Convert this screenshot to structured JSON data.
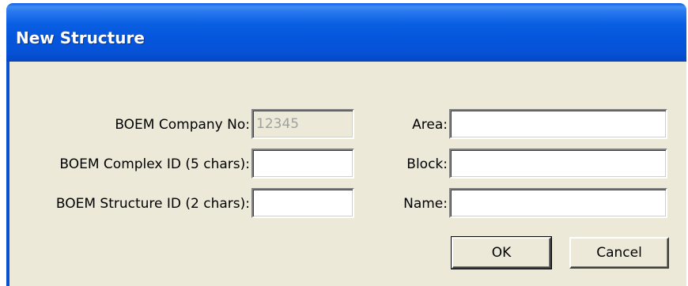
{
  "window": {
    "title": "New Structure"
  },
  "form": {
    "company_no": {
      "label": "BOEM Company No:",
      "value": "12345",
      "disabled": true
    },
    "complex_id": {
      "label": "BOEM Complex ID (5 chars):",
      "value": ""
    },
    "structure_id": {
      "label": "BOEM Structure ID (2 chars):",
      "value": ""
    },
    "area": {
      "label": "Area:",
      "value": ""
    },
    "block": {
      "label": "Block:",
      "value": ""
    },
    "name": {
      "label": "Name:",
      "value": ""
    }
  },
  "buttons": {
    "ok_label": "OK",
    "cancel_label": "Cancel"
  },
  "colors": {
    "titlebar": "#0556dc",
    "dialog_face": "#ece9d8",
    "disabled_text": "#a0a0a0"
  }
}
